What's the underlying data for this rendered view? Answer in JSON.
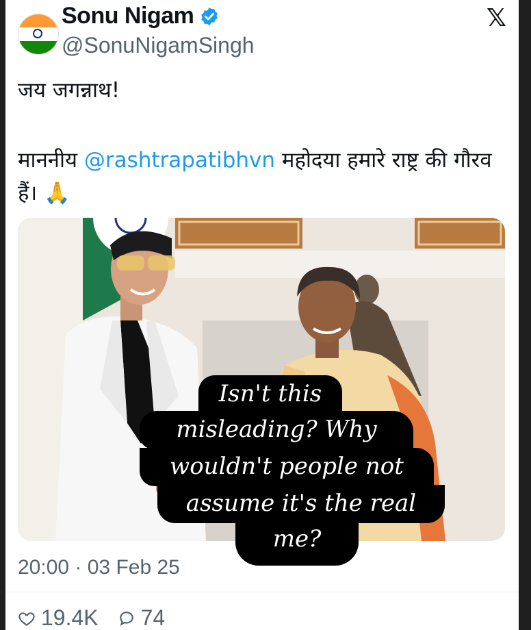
{
  "tweet": {
    "display_name": "Sonu Nigam",
    "handle": "@SonuNigamSingh",
    "text_line1": "जय जगन्नाथ!",
    "text_pre_mention": "माननीय ",
    "mention": "@rashtrapatibhvn",
    "text_post_mention": " महोदया हमारे राष्ट्र की गौरव हैं। 🙏",
    "timestamp": "20:00 · 03 Feb 25",
    "likes": "19.4K",
    "replies": "74"
  },
  "overlay": {
    "line1": "Isn't this",
    "line2": "misleading? Why",
    "line3": "wouldn't people not",
    "line4": "assume it's the real",
    "line5": "me?"
  },
  "icons": {
    "logo": "x-logo-icon",
    "verified": "verified-badge-icon",
    "like": "heart-icon",
    "reply": "reply-icon"
  },
  "colors": {
    "verified": "#1d9bf0",
    "mention": "#1d9bf0",
    "text": "#0f1419",
    "muted": "#536471"
  }
}
